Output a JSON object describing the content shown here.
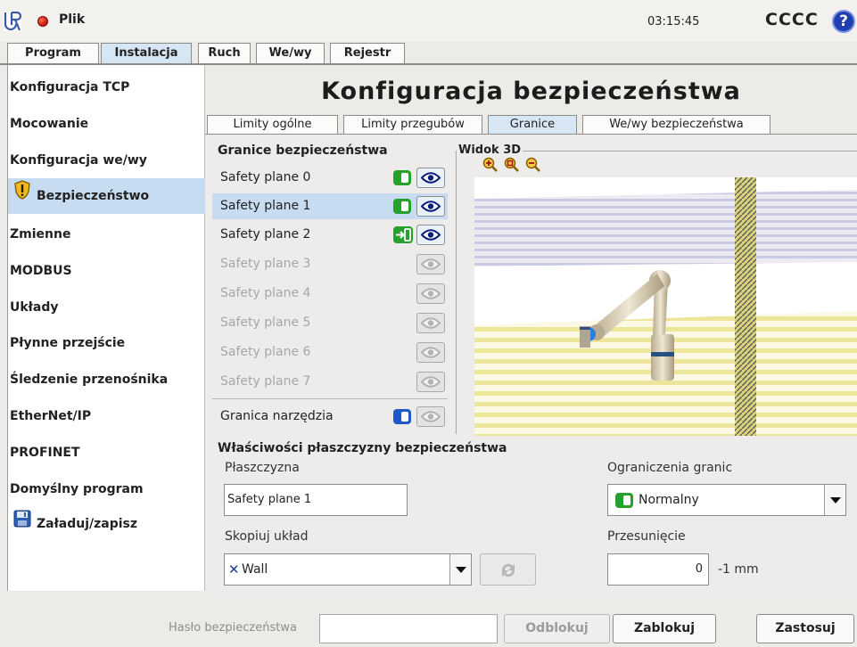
{
  "header": {
    "menu_label": "Plik",
    "time": "03:15:45",
    "robot_name": "CCCC",
    "help_symbol": "?"
  },
  "main_tabs": [
    {
      "label": "Program",
      "active": false
    },
    {
      "label": "Instalacja",
      "active": true
    },
    {
      "label": "Ruch",
      "active": false
    },
    {
      "label": "We/wy",
      "active": false
    },
    {
      "label": "Rejestr",
      "active": false
    }
  ],
  "sidebar": {
    "items": [
      {
        "label": "Konfiguracja TCP",
        "icon": null,
        "active": false
      },
      {
        "label": "Mocowanie",
        "icon": null,
        "active": false
      },
      {
        "label": "Konfiguracja we/wy",
        "icon": null,
        "active": false
      },
      {
        "label": "Bezpieczeństwo",
        "icon": "warning-shield-icon",
        "active": true
      },
      {
        "label": "Zmienne",
        "icon": null,
        "active": false
      },
      {
        "label": "MODBUS",
        "icon": null,
        "active": false
      },
      {
        "label": "Układy",
        "icon": null,
        "active": false
      },
      {
        "label": "Płynne przejście",
        "icon": null,
        "active": false
      },
      {
        "label": "Śledzenie przenośnika",
        "icon": null,
        "active": false
      },
      {
        "label": "EtherNet/IP",
        "icon": null,
        "active": false
      },
      {
        "label": "PROFINET",
        "icon": null,
        "active": false
      },
      {
        "label": "Domyślny program",
        "icon": null,
        "active": false
      },
      {
        "label": "Załaduj/zapisz",
        "icon": "floppy-disk-icon",
        "active": false
      }
    ]
  },
  "page_title": "Konfiguracja bezpieczeństwa",
  "sub_tabs": [
    {
      "label": "Limity ogólne",
      "active": false
    },
    {
      "label": "Limity przegubów",
      "active": false
    },
    {
      "label": "Granice",
      "active": true
    },
    {
      "label": "We/wy bezpieczeństwa",
      "active": false
    }
  ],
  "boundaries": {
    "title": "Granice bezpieczeństwa",
    "planes": [
      {
        "label": "Safety plane 0",
        "enabled": true,
        "mode": "normal",
        "selected": false
      },
      {
        "label": "Safety plane 1",
        "enabled": true,
        "mode": "normal",
        "selected": true
      },
      {
        "label": "Safety plane 2",
        "enabled": true,
        "mode": "trigger",
        "selected": false
      },
      {
        "label": "Safety plane 3",
        "enabled": false,
        "selected": false
      },
      {
        "label": "Safety plane 4",
        "enabled": false,
        "selected": false
      },
      {
        "label": "Safety plane 5",
        "enabled": false,
        "selected": false
      },
      {
        "label": "Safety plane 6",
        "enabled": false,
        "selected": false
      },
      {
        "label": "Safety plane 7",
        "enabled": false,
        "selected": false
      }
    ],
    "tool_boundary_label": "Granica narzędzia"
  },
  "view3d": {
    "title": "Widok 3D"
  },
  "properties": {
    "title": "Właściwości płaszczyzny bezpieczeństwa",
    "plane_label": "Płaszczyzna",
    "plane_value": "Safety plane 1",
    "copy_label": "Skopiuj układ",
    "copy_value": "Wall",
    "restriction_label": "Ograniczenia granic",
    "restriction_value": "Normalny",
    "offset_label": "Przesunięcie",
    "offset_value": "0",
    "offset_unit": "-1 mm"
  },
  "footer": {
    "password_label": "Hasło bezpieczeństwa",
    "password_value": "",
    "unlock_label": "Odblokuj",
    "lock_label": "Zablokuj",
    "apply_label": "Zastosuj"
  },
  "colors": {
    "accent_blue": "#1f3fb0",
    "selection": "#c7dcf1",
    "toggle_green": "#27a12e",
    "toggle_blue": "#2058c8"
  }
}
